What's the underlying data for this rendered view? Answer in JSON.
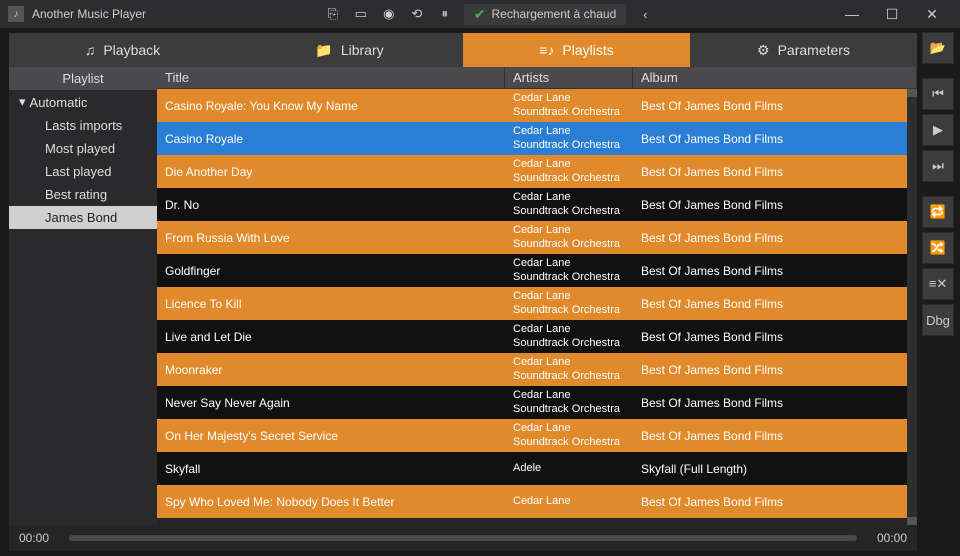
{
  "titlebar": {
    "app_title": "Another Music Player",
    "reload_label": "Rechargement à chaud"
  },
  "tabs": {
    "playback": "Playback",
    "library": "Library",
    "playlists": "Playlists",
    "parameters": "Parameters"
  },
  "sidebar": {
    "header": "Playlist",
    "automatic": "Automatic",
    "items": [
      "Lasts imports",
      "Most played",
      "Last played",
      "Best rating",
      "James Bond"
    ]
  },
  "table": {
    "headers": {
      "title": "Title",
      "artists": "Artists",
      "album": "Album"
    }
  },
  "tracks": [
    {
      "title": "Casino Royale: You Know My Name",
      "artist": "Cedar Lane Soundtrack Orchestra",
      "album": "Best Of James Bond Films",
      "style": "orange"
    },
    {
      "title": "Casino Royale",
      "artist": "Cedar Lane Soundtrack Orchestra",
      "album": "Best Of James Bond Films",
      "style": "blue"
    },
    {
      "title": "Die Another Day",
      "artist": "Cedar Lane Soundtrack Orchestra",
      "album": "Best Of James Bond Films",
      "style": "orange"
    },
    {
      "title": "Dr. No",
      "artist": "Cedar Lane Soundtrack Orchestra",
      "album": "Best Of James Bond Films",
      "style": "black"
    },
    {
      "title": "From Russia With Love",
      "artist": "Cedar Lane Soundtrack Orchestra",
      "album": "Best Of James Bond Films",
      "style": "orange"
    },
    {
      "title": "Goldfinger",
      "artist": "Cedar Lane Soundtrack Orchestra",
      "album": "Best Of James Bond Films",
      "style": "black"
    },
    {
      "title": "Licence To Kill",
      "artist": "Cedar Lane Soundtrack Orchestra",
      "album": "Best Of James Bond Films",
      "style": "orange"
    },
    {
      "title": "Live and Let Die",
      "artist": "Cedar Lane Soundtrack Orchestra",
      "album": "Best Of James Bond Films",
      "style": "black"
    },
    {
      "title": "Moonraker",
      "artist": "Cedar Lane Soundtrack Orchestra",
      "album": "Best Of James Bond Films",
      "style": "orange"
    },
    {
      "title": "Never Say Never Again",
      "artist": "Cedar Lane Soundtrack Orchestra",
      "album": "Best Of James Bond Films",
      "style": "black"
    },
    {
      "title": "On Her Majesty's Secret Service",
      "artist": "Cedar Lane Soundtrack Orchestra",
      "album": "Best Of James Bond Films",
      "style": "orange"
    },
    {
      "title": "Skyfall",
      "artist": "Adele",
      "album": "Skyfall (Full Length)",
      "style": "black"
    },
    {
      "title": "Spy Who Loved Me: Nobody Does It Better",
      "artist": "Cedar Lane",
      "album": "Best Of James Bond Films",
      "style": "orange"
    }
  ],
  "player": {
    "time_left": "00:00",
    "time_right": "00:00"
  },
  "right_tools": {
    "dbg": "Dbg"
  }
}
